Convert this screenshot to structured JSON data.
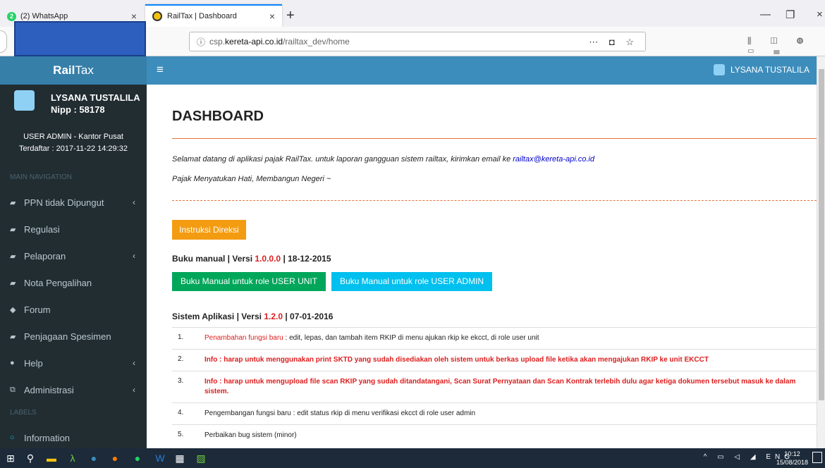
{
  "browser": {
    "tabs": [
      {
        "badge": "2",
        "title": "(2) WhatsApp"
      },
      {
        "title": "RailTax | Dashboard"
      }
    ],
    "url_prefix": "csp.",
    "url_host": "kereta-api.co.id",
    "url_path": "/railtax_dev/home"
  },
  "header": {
    "logo_a": "Rail",
    "logo_b": "Tax",
    "user": "LYSANA TUSTALILA"
  },
  "sidebar": {
    "name": "LYSANA TUSTALILA",
    "nipp": "Nipp : 58178",
    "role": "USER ADMIN - Kantor Pusat",
    "registered": "Terdaftar : 2017-11-22 14:29:32",
    "nav_header": "MAIN NAVIGATION",
    "labels_header": "LABELS",
    "items": [
      {
        "label": "PPN tidak Dipungut"
      },
      {
        "label": "Regulasi"
      },
      {
        "label": "Pelaporan"
      },
      {
        "label": "Nota Pengalihan"
      },
      {
        "label": "Forum"
      },
      {
        "label": "Penjagaan Spesimen"
      },
      {
        "label": "Help"
      },
      {
        "label": "Administrasi"
      },
      {
        "label": "Information"
      }
    ]
  },
  "main": {
    "title": "DASHBOARD",
    "welcome": "Selamat datang di aplikasi pajak RailTax. untuk laporan gangguan sistem railtax, kirimkan email ke ",
    "email": "railtax@kereta-api.co.id",
    "motto": "Pajak Menyatukan Hati, Membangun Negeri ~",
    "instruksi": "Instruksi Direksi",
    "manual_label": "Buku manual | Versi ",
    "manual_version": "1.0.0.0",
    "manual_date": " | 18-12-2015",
    "btn_unit": "Buku Manual untuk role USER UNIT",
    "btn_admin": "Buku Manual untuk role USER ADMIN",
    "sys_label": "Sistem Aplikasi | Versi ",
    "sys_version": "1.2.0",
    "sys_date": " | 07-01-2016",
    "rows": [
      {
        "no": "1.",
        "highlight": "Penambahan fungsi baru",
        "text": " : edit, lepas, dan tambah item RKIP di menu ajukan rkip ke ekcct, di role user unit"
      },
      {
        "no": "2.",
        "text": "Info : harap untuk menggunakan print SKTD yang sudah disediakan oleh sistem untuk berkas upload file ketika akan mengajukan RKIP ke unit EKCCT"
      },
      {
        "no": "3.",
        "text": "Info : harap untuk mengupload file scan RKIP yang sudah ditandatangani, Scan Surat Pernyataan dan Scan Kontrak terlebih dulu agar ketiga dokumen tersebut masuk ke dalam sistem."
      },
      {
        "no": "4.",
        "text": "Pengembangan fungsi baru : edit status rkip di menu verifikasi ekcct di role user admin"
      },
      {
        "no": "5.",
        "text": "Perbaikan bug sistem (minor)"
      }
    ]
  },
  "taskbar": {
    "lang": "ENG",
    "time": "10:12",
    "date": "15/08/2018"
  }
}
